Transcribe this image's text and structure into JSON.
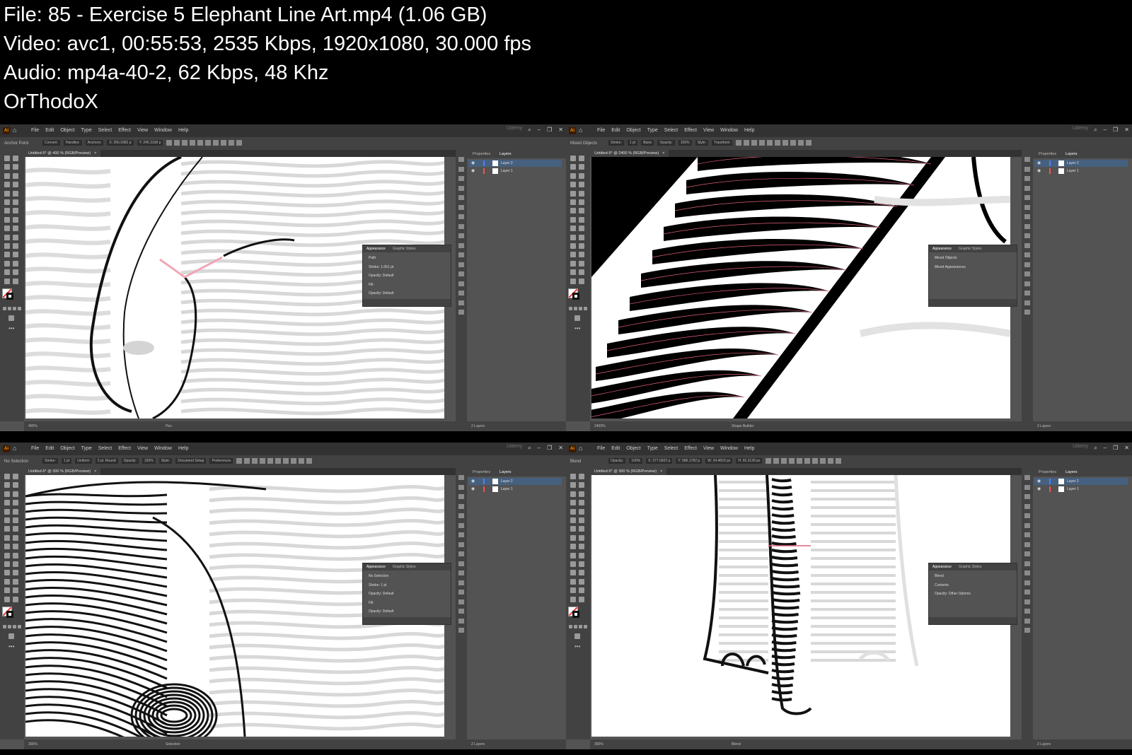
{
  "info": {
    "line1": "File: 85 - Exercise 5 Elephant Line Art.mp4 (1.06 GB)",
    "line2": "Video: avc1, 00:55:53, 2535 Kbps, 1920x1080, 30.000 fps",
    "line3": "Audio: mp4a-40-2, 62 Kbps, 48 Khz",
    "line4": "OrThodoX"
  },
  "menu": [
    "File",
    "Edit",
    "Object",
    "Type",
    "Select",
    "Effect",
    "View",
    "Window",
    "Help"
  ],
  "app_logo": "Ai",
  "window_controls": [
    "–",
    "❐",
    "✕"
  ],
  "watermark": "Udemy",
  "panels": [
    {
      "control_text": "Anchor Point",
      "control_fields": [
        "Convert:",
        "Handles:",
        "Anchors:",
        "X: 256.9382 p",
        "Y: 245.3108 p"
      ],
      "tab": "Untitled-5* @ 400 % (RGB/Preview)",
      "status_zoom": "400%",
      "status_mode": "Pen",
      "layers_tabs": [
        "Properties",
        "Layers"
      ],
      "layers": [
        {
          "name": "Layer 2",
          "selected": true,
          "color": "#4f7fff"
        },
        {
          "name": "Layer 1",
          "selected": false,
          "color": "#ff4f4f"
        }
      ],
      "layers_count": "2 Layers",
      "appearance": {
        "tabs": [
          "Appearance",
          "Graphic Styles"
        ],
        "rows": [
          "Path",
          "Stroke:  1.061 pt",
          "Opacity:  Default",
          "Fill:",
          "Opacity:  Default"
        ]
      }
    },
    {
      "control_text": "Mixed Objects",
      "control_fields": [
        "Stroke:",
        "1 pt",
        "Basic",
        "Opacity:",
        "100%",
        "Style:",
        "Transform"
      ],
      "tab": "Untitled-5* @ 2400 % (RGB/Preview)",
      "status_zoom": "2400%",
      "status_mode": "Shape Builder",
      "layers_tabs": [
        "Properties",
        "Layers"
      ],
      "layers": [
        {
          "name": "Layer 2",
          "selected": true,
          "color": "#4f7fff"
        },
        {
          "name": "Layer 1",
          "selected": false,
          "color": "#ff4f4f"
        }
      ],
      "layers_count": "2 Layers",
      "appearance": {
        "tabs": [
          "Appearance",
          "Graphic Styles"
        ],
        "rows": [
          "Mixed Objects",
          "Mixed Appearances"
        ]
      }
    },
    {
      "control_text": "No Selection",
      "control_fields": [
        "Stroke:",
        "1 pt",
        "Uniform",
        "3 pt. Round",
        "Opacity:",
        "100%",
        "Style:",
        "Document Setup",
        "Preferences"
      ],
      "tab": "Untitled-5* @ 300 % (RGB/Preview)",
      "status_zoom": "300%",
      "status_mode": "Selection",
      "layers_tabs": [
        "Properties",
        "Layers"
      ],
      "layers": [
        {
          "name": "Layer 2",
          "selected": true,
          "color": "#4f7fff"
        },
        {
          "name": "Layer 1",
          "selected": false,
          "color": "#ff4f4f"
        }
      ],
      "layers_count": "2 Layers",
      "appearance": {
        "tabs": [
          "Appearance",
          "Graphic Styles"
        ],
        "rows": [
          "No Selection",
          "Stroke:  1 pt",
          "Opacity:  Default",
          "Fill:",
          "Opacity:  Default"
        ]
      }
    },
    {
      "control_text": "Blend",
      "control_fields": [
        "Opacity:",
        "100%",
        "X: 377.0922 p",
        "Y: 586.1782 p",
        "W: 24.4823 px",
        "H: 92.3139 px"
      ],
      "tab": "Untitled-5* @ 300 % (RGB/Preview)",
      "status_zoom": "300%",
      "status_mode": "Blend",
      "layers_tabs": [
        "Properties",
        "Layers"
      ],
      "layers": [
        {
          "name": "Layer 2",
          "selected": true,
          "color": "#4f7fff"
        },
        {
          "name": "Layer 1",
          "selected": false,
          "color": "#ff4f4f"
        }
      ],
      "layers_count": "2 Layers",
      "appearance": {
        "tabs": [
          "Appearance",
          "Graphic Styles"
        ],
        "rows": [
          "Blend",
          "Contents",
          "Opacity:  Other Options"
        ]
      }
    }
  ]
}
